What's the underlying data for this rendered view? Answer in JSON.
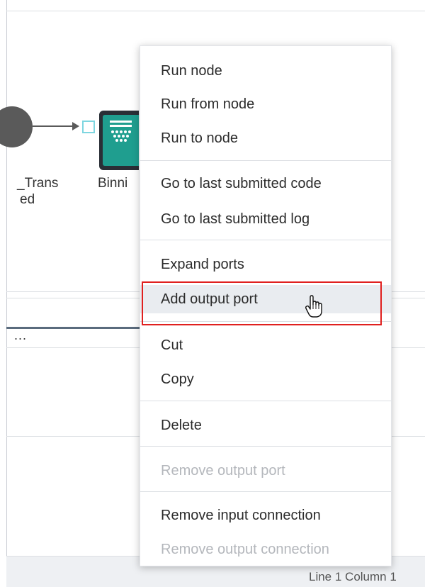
{
  "canvas": {
    "node_left_label_line1": "_Trans",
    "node_left_label_line2": "ed",
    "binning_label": "Binni"
  },
  "context_menu": {
    "groups": [
      [
        "Run node",
        "Run from node",
        "Run to node"
      ],
      [
        "Go to last submitted code",
        "Go to last submitted log"
      ],
      [
        "Expand ports",
        "Add output port"
      ],
      [
        "Cut",
        "Copy"
      ],
      [
        "Delete"
      ],
      [
        "Remove output port"
      ],
      [
        "Remove input connection",
        "Remove output connection"
      ]
    ],
    "items": {
      "run_node": "Run node",
      "run_from_node": "Run from node",
      "run_to_node": "Run to node",
      "go_last_code": "Go to last submitted code",
      "go_last_log": "Go to last submitted log",
      "expand_ports": "Expand ports",
      "add_output_port": "Add output port",
      "cut": "Cut",
      "copy": "Copy",
      "delete": "Delete",
      "remove_output_port": "Remove output port",
      "remove_input_connection": "Remove input connection",
      "remove_output_connection": "Remove output connection"
    },
    "disabled": [
      "Remove output port",
      "Remove output connection"
    ],
    "highlighted": "Add output port"
  },
  "lower_panel": {
    "tab_overflow": "..."
  },
  "status_bar": {
    "position_text": "Line 1 Column 1"
  },
  "colors": {
    "highlight_border": "#e0201f",
    "node_fill": "#1f9e8f",
    "port_border": "#7ed6e0"
  },
  "icons": {
    "binning_node": "binning-icon",
    "cursor": "pointer-hand-icon"
  }
}
